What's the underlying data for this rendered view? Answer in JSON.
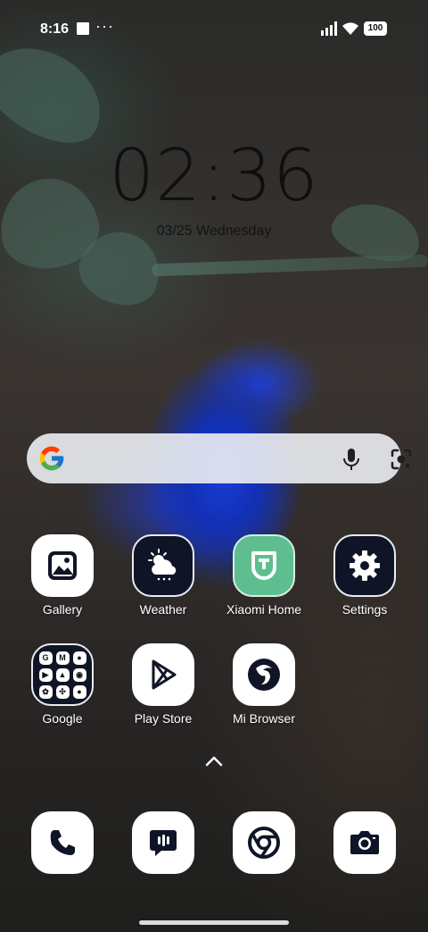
{
  "status_bar": {
    "time": "8:16",
    "battery": "100",
    "overflow": "···"
  },
  "clock": {
    "time": "02:36",
    "date": "03/25 Wednesday"
  },
  "search_bar": {
    "logo": "google-g-icon",
    "mic": "microphone-icon",
    "lens": "camera-lens-icon"
  },
  "apps_row1": [
    {
      "label": "Gallery",
      "icon": "gallery-icon"
    },
    {
      "label": "Weather",
      "icon": "weather-icon"
    },
    {
      "label": "Xiaomi Home",
      "icon": "xiaomi-home-icon"
    },
    {
      "label": "Settings",
      "icon": "gear-icon"
    }
  ],
  "apps_row2": [
    {
      "label": "Google",
      "icon": "google-folder-icon"
    },
    {
      "label": "Play Store",
      "icon": "play-store-icon"
    },
    {
      "label": "Mi Browser",
      "icon": "mi-browser-icon"
    }
  ],
  "google_folder": [
    "G",
    "M",
    "",
    "",
    "",
    "",
    "",
    "",
    ""
  ],
  "dock": [
    {
      "icon": "phone-icon"
    },
    {
      "icon": "messages-icon"
    },
    {
      "icon": "chrome-icon"
    },
    {
      "icon": "camera-icon"
    }
  ],
  "colors": {
    "flower_blue": "#1a3cd6",
    "xiaomi_green": "#5fbe8f",
    "dark_icon_bg": "#0f1526"
  }
}
